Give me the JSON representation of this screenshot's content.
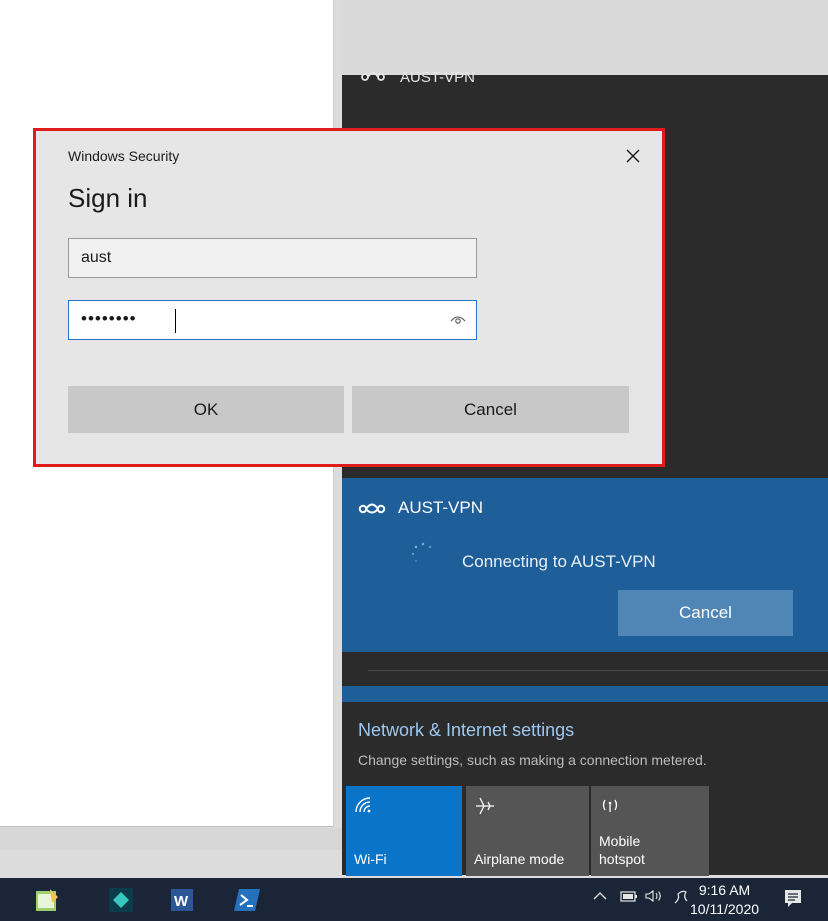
{
  "dialog": {
    "caption": "Windows Security",
    "title": "Sign in",
    "username_value": "aust",
    "password_dots": "••••••••",
    "ok_label": "OK",
    "cancel_label": "Cancel"
  },
  "flyout": {
    "top_vpn_name": "AUST-VPN",
    "vpn_name": "AUST-VPN",
    "connecting_text": "Connecting to AUST-VPN",
    "cancel_label": "Cancel",
    "settings_title": "Network & Internet settings",
    "settings_subtitle": "Change settings, such as making a connection metered.",
    "tiles": [
      {
        "label": "Wi-Fi",
        "icon": "wifi-icon"
      },
      {
        "label": "Airplane mode",
        "icon": "airplane-icon"
      },
      {
        "label": "Mobile hotspot",
        "icon": "hotspot-icon"
      }
    ]
  },
  "taskbar": {
    "time": "9:16 AM",
    "date": "10/11/2020",
    "apps": [
      "notepad-app-icon",
      "app-diamond-icon",
      "word-app-icon",
      "powershell-app-icon"
    ]
  },
  "colors": {
    "accent_blue": "#1e5f9a",
    "wifi_tile": "#0a74c9",
    "highlight_red": "#e11b1b"
  }
}
